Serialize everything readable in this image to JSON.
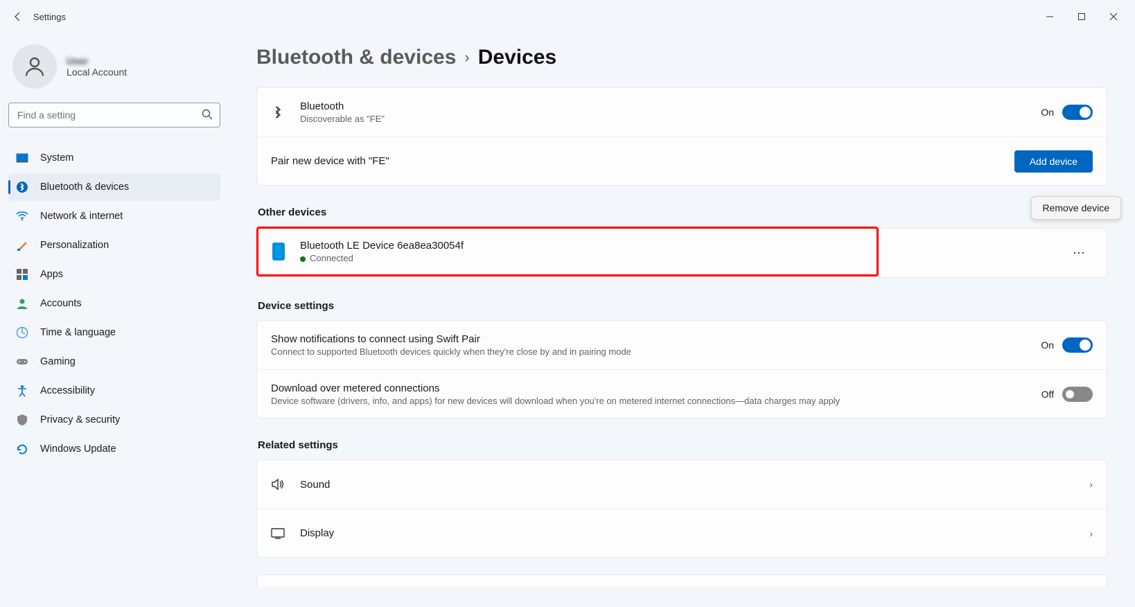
{
  "window": {
    "title": "Settings"
  },
  "profile": {
    "name": "User",
    "subtitle": "Local Account"
  },
  "search": {
    "placeholder": "Find a setting"
  },
  "nav": {
    "items": [
      {
        "label": "System"
      },
      {
        "label": "Bluetooth & devices"
      },
      {
        "label": "Network & internet"
      },
      {
        "label": "Personalization"
      },
      {
        "label": "Apps"
      },
      {
        "label": "Accounts"
      },
      {
        "label": "Time & language"
      },
      {
        "label": "Gaming"
      },
      {
        "label": "Accessibility"
      },
      {
        "label": "Privacy & security"
      },
      {
        "label": "Windows Update"
      }
    ]
  },
  "breadcrumb": {
    "parent": "Bluetooth & devices",
    "current": "Devices"
  },
  "bluetooth": {
    "title": "Bluetooth",
    "subtitle": "Discoverable as \"FE\"",
    "state_label": "On"
  },
  "pair": {
    "text": "Pair new device with \"FE\"",
    "button": "Add device"
  },
  "sections": {
    "other_devices": "Other devices",
    "device_settings": "Device settings",
    "related_settings": "Related settings"
  },
  "device": {
    "name": "Bluetooth LE Device 6ea8ea30054f",
    "status": "Connected",
    "menu_tooltip": "Remove device"
  },
  "settings": {
    "swift_pair": {
      "title": "Show notifications to connect using Swift Pair",
      "subtitle": "Connect to supported Bluetooth devices quickly when they're close by and in pairing mode",
      "state_label": "On"
    },
    "metered": {
      "title": "Download over metered connections",
      "subtitle": "Device software (drivers, info, and apps) for new devices will download when you're on metered internet connections—data charges may apply",
      "state_label": "Off"
    }
  },
  "related": {
    "sound": "Sound",
    "display": "Display"
  }
}
